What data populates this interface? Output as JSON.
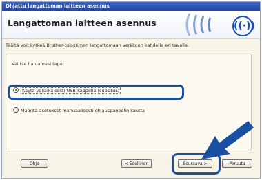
{
  "window": {
    "title": "Ohjattu langattoman laitteen asennus"
  },
  "header": {
    "title": "Langattoman laitteen asennus",
    "logo_icon": "wifi-icon"
  },
  "intro": "Täältä voit kytkeä Brother-tulostimen langattomaan verkkoon kahdella eri tavalla.",
  "panel": {
    "prompt": "Valitse haluamasi tapa:",
    "options": [
      {
        "label": "Käytä väliaikaisesti USB-kaapelia (suositus)",
        "selected": true
      },
      {
        "label": "Määritä asetukset manuaalisesti ohjauspaneelin kautta",
        "selected": false
      }
    ]
  },
  "buttons": {
    "help": "Ohje",
    "back": "< Edellinen",
    "next": "Seuraava >",
    "cancel": "Peruuta"
  },
  "colors": {
    "highlight": "#1a4fa3",
    "titlebar": "#2a52b8"
  }
}
